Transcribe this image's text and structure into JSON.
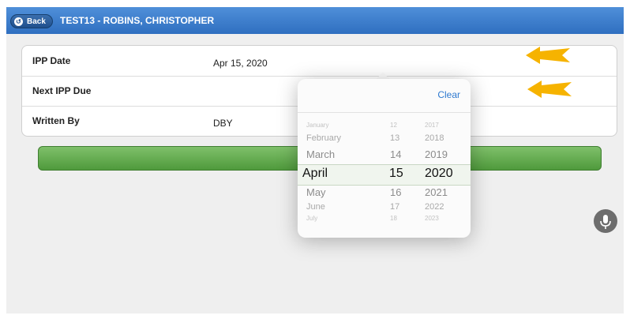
{
  "header": {
    "back_label": "Back",
    "title": "TEST13 - ROBINS, CHRISTOPHER"
  },
  "form": {
    "rows": [
      {
        "label": "IPP Date",
        "value": "Apr 15, 2020"
      },
      {
        "label": "Next IPP Due",
        "value": ""
      },
      {
        "label": "Written By",
        "value": "DBY"
      }
    ]
  },
  "picker": {
    "clear_label": "Clear",
    "months": [
      "January",
      "February",
      "March",
      "April",
      "May",
      "June",
      "July"
    ],
    "days": [
      "12",
      "13",
      "14",
      "15",
      "16",
      "17",
      "18"
    ],
    "years": [
      "2017",
      "2018",
      "2019",
      "2020",
      "2021",
      "2022",
      "2023"
    ],
    "selected": {
      "month": "April",
      "day": "15",
      "year": "2020"
    }
  },
  "colors": {
    "header": "#3f7fcf",
    "annotation_arrow": "#f6b300",
    "action_bar": "#5fa84a",
    "clear_text": "#2f7ad0"
  },
  "icons": {
    "back": "back-arrow-icon",
    "mic": "microphone-icon",
    "annotation": "arrow-left-icon"
  }
}
